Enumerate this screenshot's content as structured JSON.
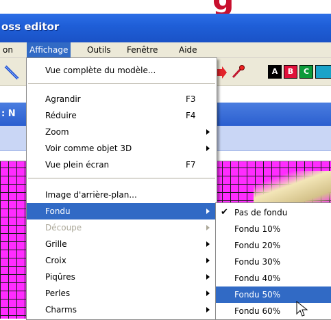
{
  "brand_text": "g",
  "window": {
    "title": "oss editor"
  },
  "menubar": {
    "items": [
      {
        "label": "on"
      },
      {
        "label": "Affichage"
      },
      {
        "label": "Outils"
      },
      {
        "label": "Fenêtre"
      },
      {
        "label": "Aide"
      }
    ]
  },
  "toolbar": {
    "color_swatches": [
      {
        "label": "A",
        "color": "#000000",
        "text_color": "#ffffff"
      },
      {
        "label": "B",
        "color": "#e0103a",
        "text_color": "#ffffff"
      },
      {
        "label": "C",
        "color": "#0b9a3a",
        "text_color": "#ffffff"
      },
      {
        "label": "",
        "color": "#1aa3c8",
        "text_color": "#ffffff"
      }
    ]
  },
  "infobar": {
    "text": ": N"
  },
  "affichage_menu": {
    "items": [
      {
        "label": "Vue complète du modèle...",
        "shortcut": ""
      },
      {
        "label": "Agrandir",
        "shortcut": "F3"
      },
      {
        "label": "Réduire",
        "shortcut": "F4"
      },
      {
        "label": "Zoom",
        "shortcut": ""
      },
      {
        "label": "Voir comme objet 3D",
        "shortcut": ""
      },
      {
        "label": "Vue plein écran",
        "shortcut": "F7"
      },
      {
        "label": "Image d'arrière-plan...",
        "shortcut": ""
      },
      {
        "label": "Fondu",
        "shortcut": ""
      },
      {
        "label": "Découpe",
        "shortcut": ""
      },
      {
        "label": "Grille",
        "shortcut": ""
      },
      {
        "label": "Croix",
        "shortcut": ""
      },
      {
        "label": "Piqûres",
        "shortcut": ""
      },
      {
        "label": "Perles",
        "shortcut": ""
      },
      {
        "label": "Charms",
        "shortcut": ""
      }
    ]
  },
  "fondu_submenu": {
    "items": [
      {
        "label": "Pas de fondu",
        "checked": true
      },
      {
        "label": "Fondu 10%",
        "checked": false
      },
      {
        "label": "Fondu 20%",
        "checked": false
      },
      {
        "label": "Fondu 30%",
        "checked": false
      },
      {
        "label": "Fondu 40%",
        "checked": false
      },
      {
        "label": "Fondu 50%",
        "checked": false
      },
      {
        "label": "Fondu 60%",
        "checked": false
      }
    ],
    "check_glyph": "✔"
  },
  "colors": {
    "menu_highlight": "#316ac5",
    "canvas_fill": "#ff2cff",
    "title_blue": "#1f5fd8"
  }
}
